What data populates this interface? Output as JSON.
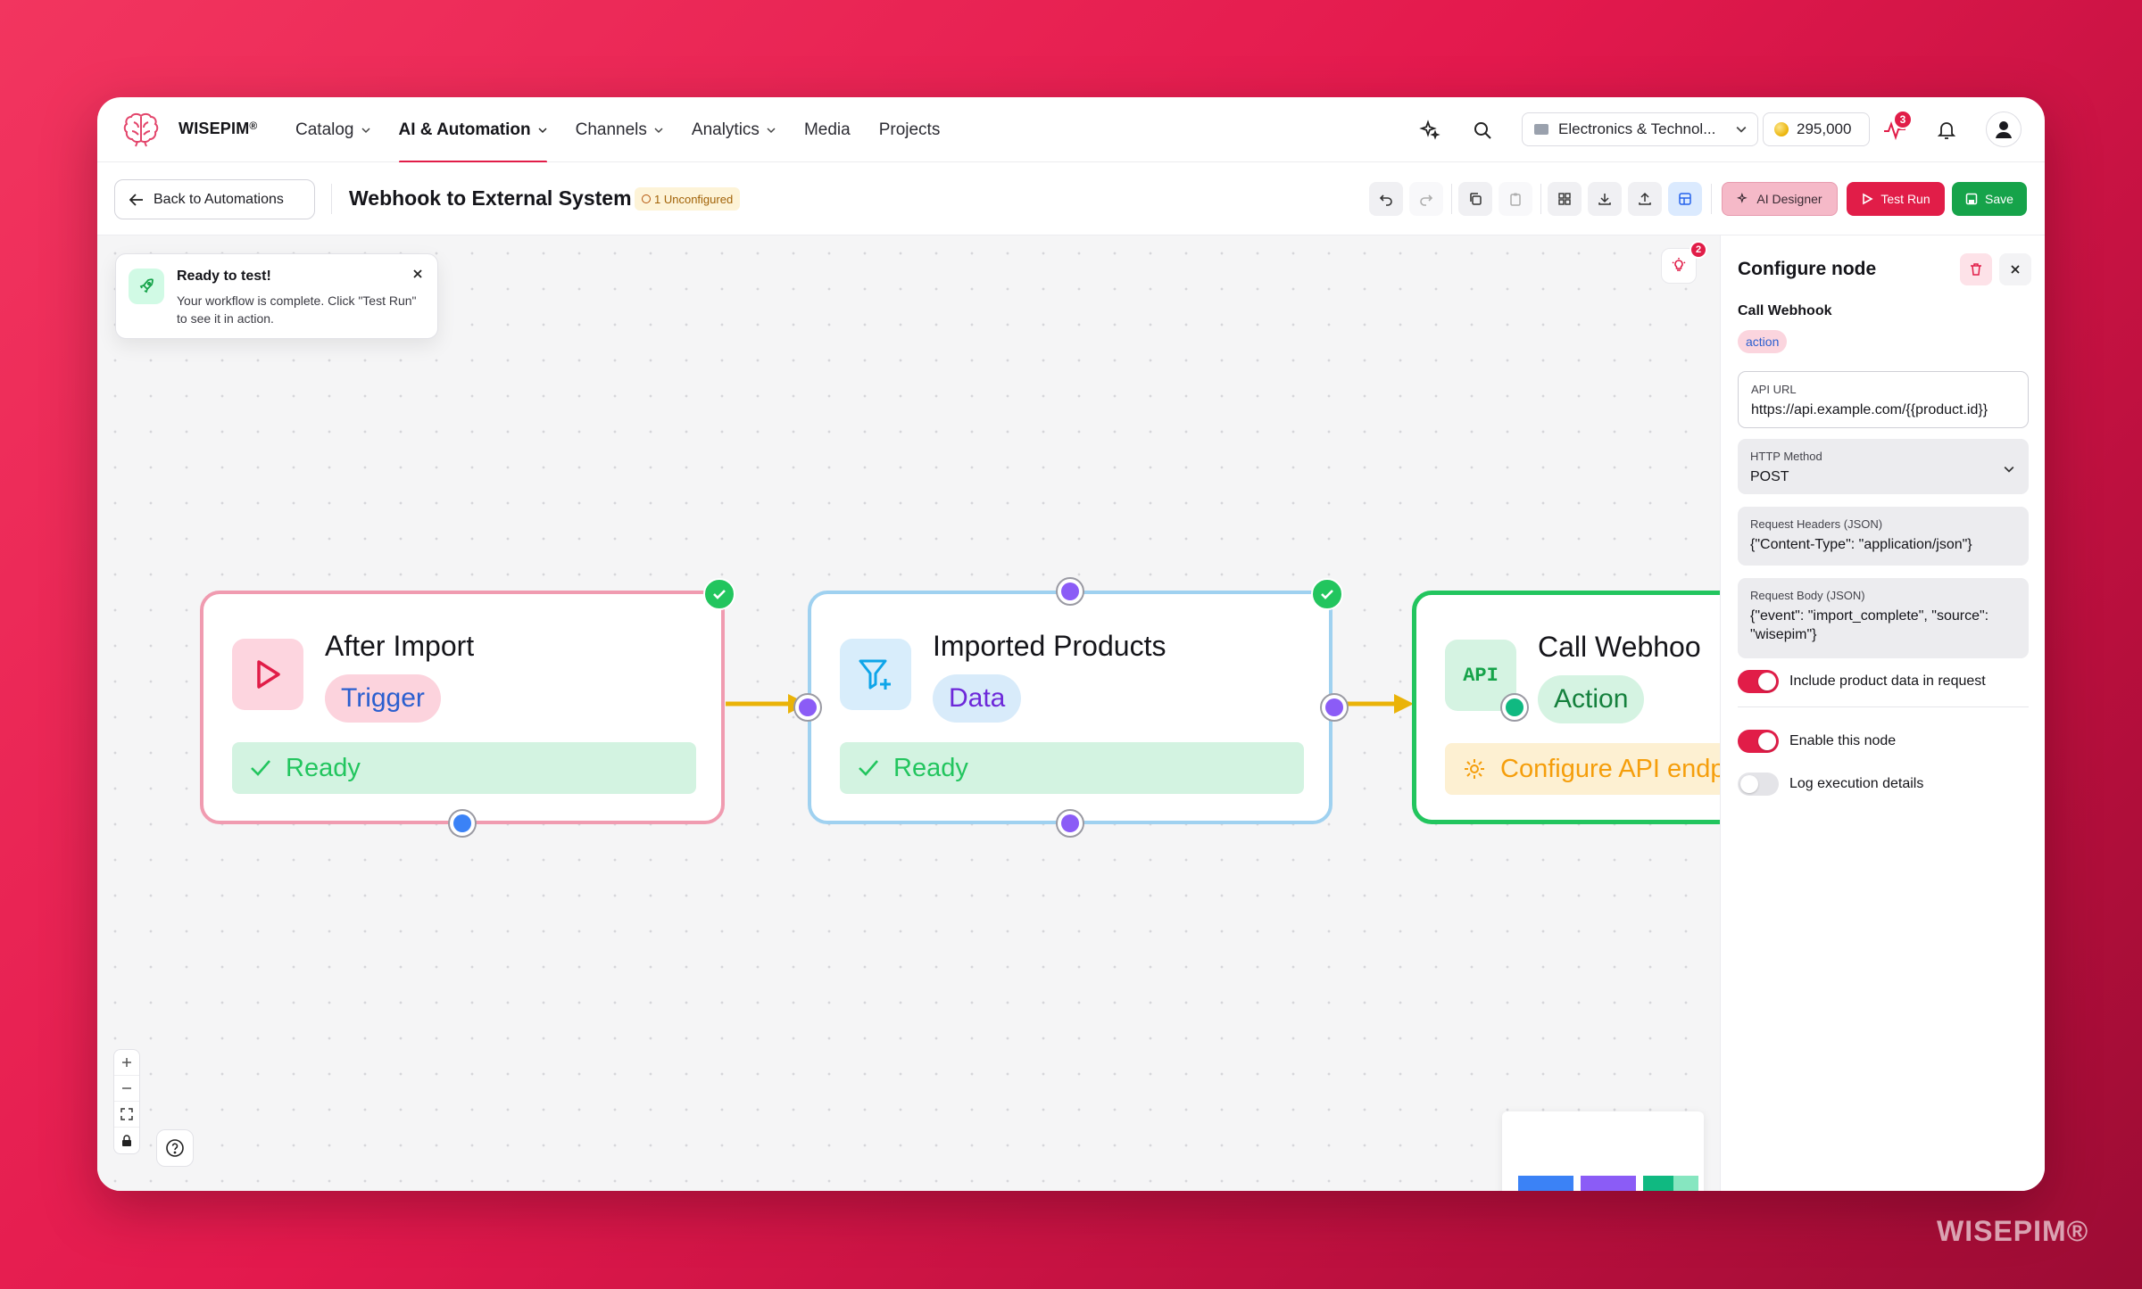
{
  "app": {
    "brand": "WISEPIM",
    "brand_mark": "®",
    "watermark": "WISEPIM®"
  },
  "nav": {
    "items": [
      {
        "label": "Catalog",
        "has_dropdown": true,
        "active": false
      },
      {
        "label": "AI & Automation",
        "has_dropdown": true,
        "active": true
      },
      {
        "label": "Channels",
        "has_dropdown": true,
        "active": false
      },
      {
        "label": "Analytics",
        "has_dropdown": true,
        "active": false
      },
      {
        "label": "Media",
        "has_dropdown": false,
        "active": false
      },
      {
        "label": "Projects",
        "has_dropdown": false,
        "active": false
      }
    ],
    "store_selector": "Electronics & Technol...",
    "credits": "295,000",
    "activity_badge": "3",
    "icons": [
      "sparkles-icon",
      "search-icon",
      "activity-icon",
      "bell-icon",
      "user-icon"
    ]
  },
  "toolbar": {
    "back_label": "Back to Automations",
    "title": "Webhook to External System",
    "unconfigured_badge": "1 Unconfigured",
    "ai_designer_label": "AI Designer",
    "test_run_label": "Test Run",
    "save_label": "Save"
  },
  "toast": {
    "title": "Ready to test!",
    "text": "Your workflow is complete. Click \"Test Run\" to see it in action."
  },
  "canvas": {
    "hint_badge": "2",
    "nodes": [
      {
        "title": "After Import",
        "type_label": "Trigger",
        "status": "Ready",
        "status_kind": "ready",
        "icon": "play-icon",
        "color": "#f09bb0"
      },
      {
        "title": "Imported Products",
        "type_label": "Data",
        "status": "Ready",
        "status_kind": "ready",
        "icon": "filter-plus-icon",
        "color": "#9fd1f0"
      },
      {
        "title": "Call Webhoo",
        "type_label": "Action",
        "status": "Configure API endp",
        "status_kind": "warning",
        "icon": "api-icon",
        "color": "#22c55e"
      }
    ],
    "edge_color": "#eab308",
    "minimap_colors": [
      "#3b82f6",
      "#8b5cf6",
      "#10b981"
    ]
  },
  "panel": {
    "title": "Configure node",
    "node_name": "Call Webhook",
    "node_type": "action",
    "api_url": {
      "label": "API URL",
      "value": "https://api.example.com/{{product.id}}"
    },
    "http_method": {
      "label": "HTTP Method",
      "value": "POST"
    },
    "headers": {
      "label": "Request Headers (JSON)",
      "value": "{\"Content-Type\": \"application/json\"}"
    },
    "body": {
      "label": "Request Body (JSON)",
      "value": "{\"event\": \"import_complete\", \"source\": \"wisepim\"}"
    },
    "toggles": [
      {
        "label": "Include product data in request",
        "on": true
      },
      {
        "label": "Enable this node",
        "on": true
      },
      {
        "label": "Log execution details",
        "on": false
      }
    ]
  }
}
